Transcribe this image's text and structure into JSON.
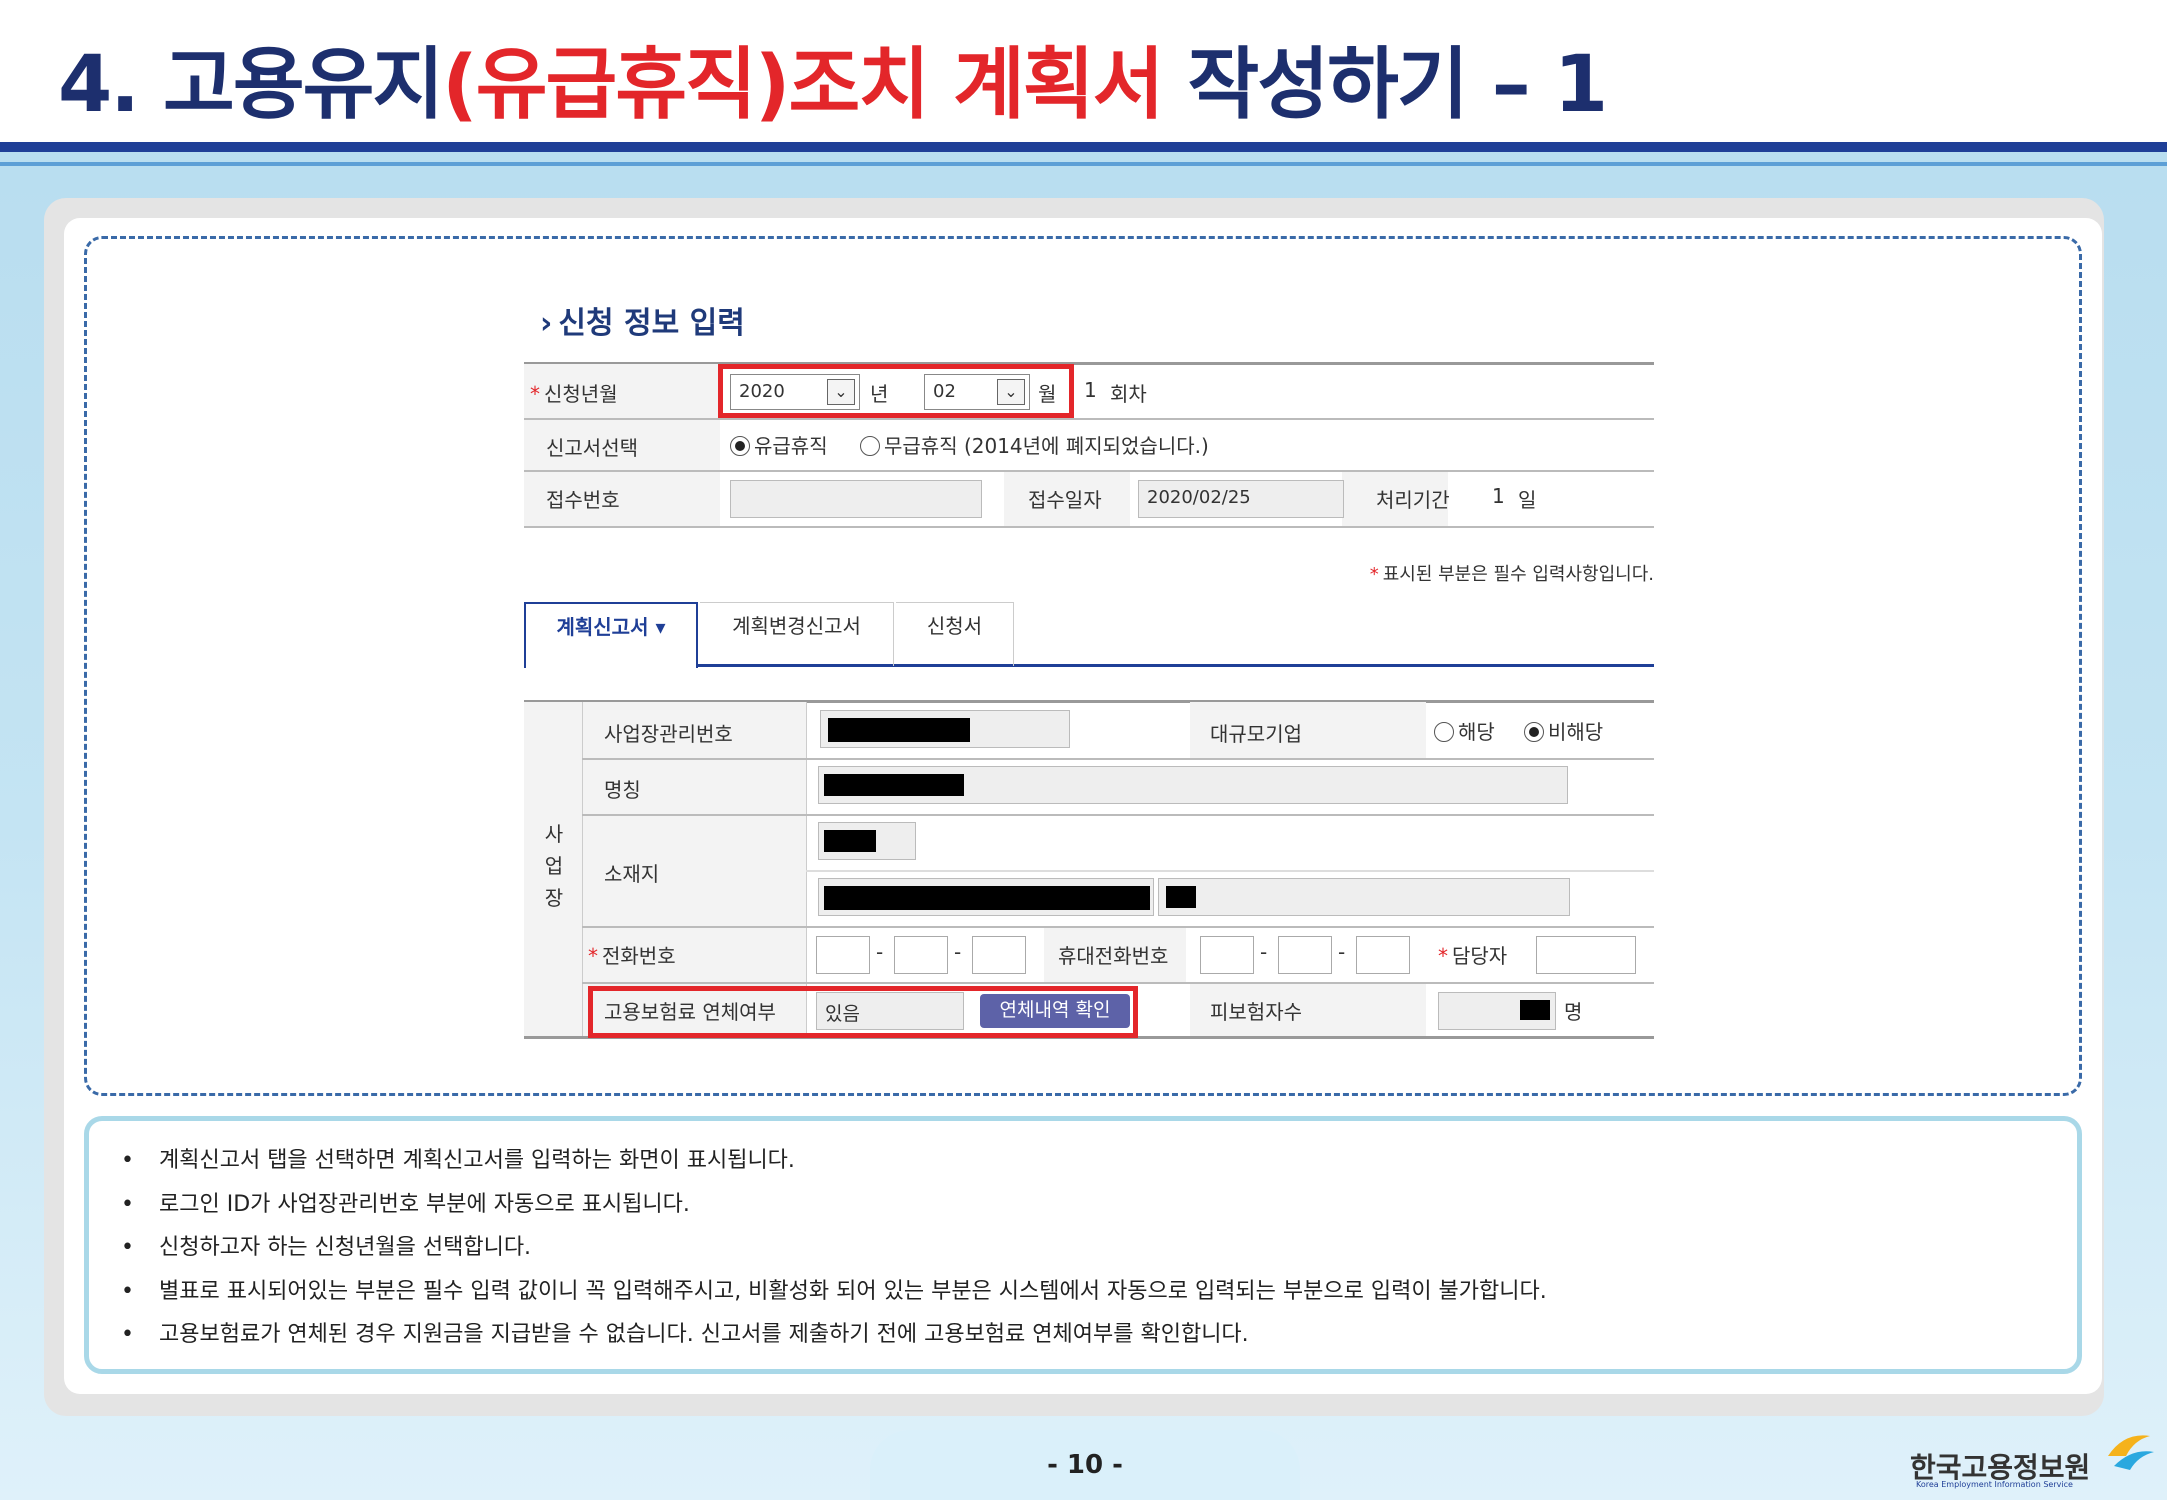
{
  "page": {
    "title_part1": "4. 고용유지",
    "title_part2": "(유급휴직)조치 계획서",
    "title_part3": " 작성하기 – 1",
    "page_number": "- 10 -",
    "logo_text": "한국고용정보원",
    "logo_subtext": "Korea Employment Information Service"
  },
  "form": {
    "section_title": "신청 정보 입력",
    "apply_ym_label": "신청년월",
    "year_value": "2020",
    "year_unit": "년",
    "month_value": "02",
    "month_unit": "월",
    "round_count": "1",
    "round_unit": "회차",
    "report_type_label": "신고서선택",
    "report_type_paid": "유급휴직",
    "report_type_unpaid": "무급휴직 (2014년에 폐지되었습니다.)",
    "receipt_no_label": "접수번호",
    "receipt_no_value": "",
    "receipt_date_label": "접수일자",
    "receipt_date_value": "2020/02/25",
    "process_period_label": "처리기간",
    "process_period_value": "1",
    "process_period_unit": "일",
    "required_note": "표시된 부분은 필수 입력사항입니다.",
    "tabs": [
      {
        "label": "계획신고서 ▾"
      },
      {
        "label": "계획변경신고서"
      },
      {
        "label": "신청서"
      }
    ],
    "workplace_group_label": "사업장",
    "biz_no_label": "사업장관리번호",
    "large_corp_label": "대규모기업",
    "large_corp_yes": "해당",
    "large_corp_no": "비해당",
    "name_label": "명칭",
    "address_label": "소재지",
    "phone_label": "전화번호",
    "mobile_label": "휴대전화번호",
    "manager_label": "담당자",
    "overdue_label": "고용보험료 연체여부",
    "overdue_value": "있음",
    "overdue_button": "연체내역 확인",
    "insured_label": "피보험자수",
    "insured_unit": "명",
    "dash": "-"
  },
  "notes": [
    "계획신고서 탭을 선택하면 계획신고서를 입력하는 화면이 표시됩니다.",
    "로그인 ID가 사업장관리번호 부분에 자동으로 표시됩니다.",
    "신청하고자 하는 신청년월을 선택합니다.",
    "별표로 표시되어있는 부분은 필수 입력 값이니 꼭 입력해주시고, 비활성화 되어 있는 부분은 시스템에서 자동으로 입력되는 부분으로 입력이 불가합니다.",
    "고용보험료가 연체된 경우 지원금을 지급받을 수 없습니다. 신고서를 제출하기 전에 고용보험료 연체여부를 확인합니다."
  ],
  "colors": {
    "title_navy": "#1d2f6e",
    "title_red": "#e3262a",
    "accent_blue": "#1f3f97",
    "highlight_red": "#e3262a",
    "button_purple": "#5d62a8"
  }
}
